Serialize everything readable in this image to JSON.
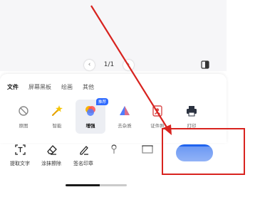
{
  "pager": {
    "prev_icon": "chevron-left-icon",
    "page_indicator": "1/1",
    "next_icon": "chevron-right-icon"
  },
  "view_toggle_icon": "split-view-icon",
  "tabs": [
    {
      "label": "文件",
      "active": true
    },
    {
      "label": "屏幕黑板",
      "active": false
    },
    {
      "label": "绘画",
      "active": false
    },
    {
      "label": "其他",
      "active": false
    }
  ],
  "filters": [
    {
      "label": "原图",
      "icon": "no-filter-icon",
      "selected": false
    },
    {
      "label": "智能",
      "icon": "magic-wand-icon",
      "selected": false
    },
    {
      "label": "增强",
      "icon": "color-enhance-icon",
      "selected": true,
      "badge": "推荐"
    },
    {
      "label": "去杂质",
      "icon": "shadow-remove-icon",
      "selected": false
    },
    {
      "label": "证件照",
      "icon": "id-photo-icon",
      "selected": false
    },
    {
      "label": "打印",
      "icon": "printer-icon",
      "selected": false
    }
  ],
  "tools": [
    {
      "label": "提取文字",
      "icon": "text-extract-icon"
    },
    {
      "label": "涂抹擦除",
      "icon": "eraser-icon"
    },
    {
      "label": "签名印章",
      "icon": "signature-icon"
    }
  ],
  "colors": {
    "accent": "#1f63ee",
    "badge": "#2f6bff",
    "annotation": "#d8231f"
  }
}
